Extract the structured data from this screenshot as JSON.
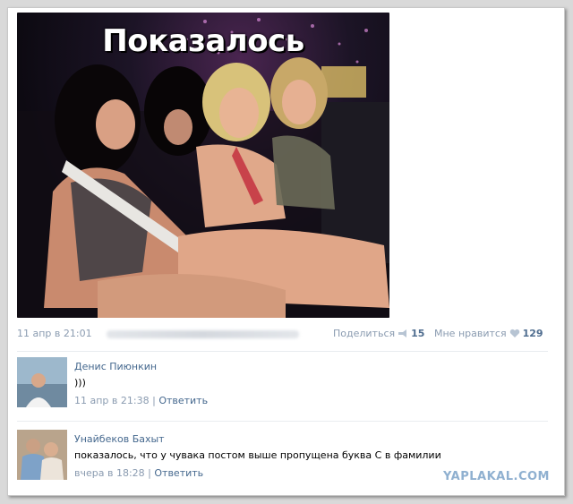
{
  "post": {
    "image_caption": "Показалось",
    "date": "11 апр в 21:01",
    "share_label": "Поделиться",
    "share_count": "15",
    "like_label": "Мне нравится",
    "like_count": "129"
  },
  "comments": [
    {
      "author": "Денис Пиюнкин",
      "text": ")))",
      "time": "11 апр в 21:38",
      "separator": "|",
      "reply_label": "Ответить"
    },
    {
      "author": "Унайбеков Бахыт",
      "text": "показалось, что у чувака постом выше пропущена буква С в фамилии",
      "time": "вчера в 18:28",
      "separator": "|",
      "reply_label": "Ответить"
    }
  ],
  "watermark": "YAPLAKAL.COM",
  "colors": {
    "link": "#45688e",
    "meta": "#8a9bb0",
    "counter": "#4f6d8f",
    "watermark": "#8fb0d0"
  },
  "icons": {
    "share": "megaphone-icon",
    "like": "heart-icon"
  }
}
